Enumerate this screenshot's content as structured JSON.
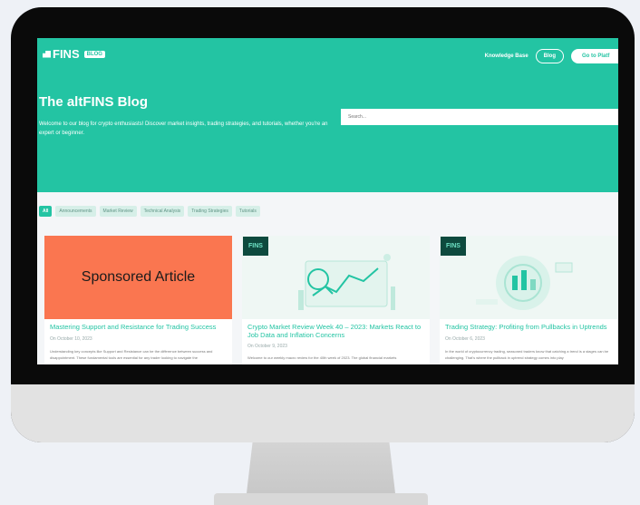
{
  "header": {
    "logo": "FINS",
    "badge": "BLOG",
    "nav": [
      "Knowledge Base",
      "Blog",
      "Go to Platf"
    ]
  },
  "hero": {
    "title": "The altFINS Blog",
    "subtitle": "Welcome to our blog for crypto enthusiasts! Discover market insights, trading strategies, and tutorials, whether you're an expert or beginner.",
    "search_placeholder": "Search..."
  },
  "filters": [
    "All",
    "Announcements",
    "Market Review",
    "Technical Analysis",
    "Trading Strategies",
    "Tutorials"
  ],
  "active_filter": "All",
  "cards": [
    {
      "overlay": "Sponsored Article",
      "title": "Mastering Support and Resistance for Trading Success",
      "date": "On October 10, 2023",
      "excerpt": "Understanding key concepts like Support and Resistance can be the difference between success and disappointment. These fundamental tools are essential for any trader looking to navigate the"
    },
    {
      "tag": "FINS",
      "title": "Crypto Market Review Week 40 – 2023: Markets React to Job Data and Inflation Concerns",
      "date": "On October 9, 2023",
      "excerpt": "Welcome to our weekly macro review for the 40th week of 2023. The global financial markets"
    },
    {
      "tag": "FINS",
      "title": "Trading Strategy: Profiting from Pullbacks in Uptrends",
      "date": "On October 6, 2023",
      "excerpt": "In the world of cryptocurrency trading, seasoned traders know that catching a trend is a stages can be challenging. That's where the pullback in uptrend strategy comes into play"
    }
  ],
  "colors": {
    "brand": "#23c4a3",
    "sponsored": "#fa7650",
    "bezel": "#0a0a0a"
  }
}
